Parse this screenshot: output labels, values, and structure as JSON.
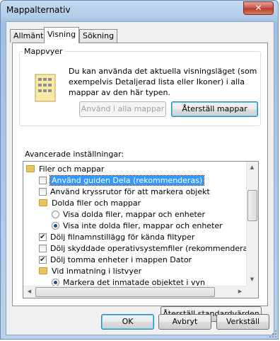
{
  "window": {
    "title": "Mappalternativ",
    "close_glyph": "✕"
  },
  "tabs": [
    {
      "label": "Allmänt"
    },
    {
      "label": "Visning"
    },
    {
      "label": "Sökning"
    }
  ],
  "folder_views": {
    "group_label": "Mappvyer",
    "description": "Du kan använda det aktuella visningsläget (som exempelvis Detaljerad lista eller Ikoner) i alla mappar av den här typen.",
    "apply_label": "Använd i alla mappar",
    "reset_label": "Återställ mappar"
  },
  "advanced": {
    "label": "Avancerade inställningar:",
    "items": [
      {
        "type": "folder",
        "text": "Filer och mappar"
      },
      {
        "type": "checkbox",
        "checked": false,
        "selected": true,
        "text": "Använd guiden Dela (rekommenderas)"
      },
      {
        "type": "checkbox",
        "checked": false,
        "text": "Använd kryssrutor för att markera objekt"
      },
      {
        "type": "folder",
        "text": "Dolda filer och mappar"
      },
      {
        "type": "radio",
        "checked": false,
        "text": "Visa dolda filer, mappar och enheter"
      },
      {
        "type": "radio",
        "checked": true,
        "text": "Visa inte dolda filer, mappar och enheter"
      },
      {
        "type": "checkbox",
        "checked": true,
        "text": "Dölj filnamnstillägg för kända filtyper"
      },
      {
        "type": "checkbox",
        "checked": false,
        "text": "Dölj skyddade operativsystemfiler (rekommenderas)"
      },
      {
        "type": "checkbox",
        "checked": true,
        "text": "Dölj tomma enheter i mappen Dator"
      },
      {
        "type": "folder",
        "text": "Vid inmatning i listvyer"
      },
      {
        "type": "radio",
        "checked": true,
        "text": "Markera det inmatade objektet i vyn"
      }
    ],
    "restore_defaults_label": "Återställ standardvärden"
  },
  "dialog_buttons": {
    "ok": "OK",
    "cancel": "Avbryt",
    "apply": "Verkställ"
  }
}
